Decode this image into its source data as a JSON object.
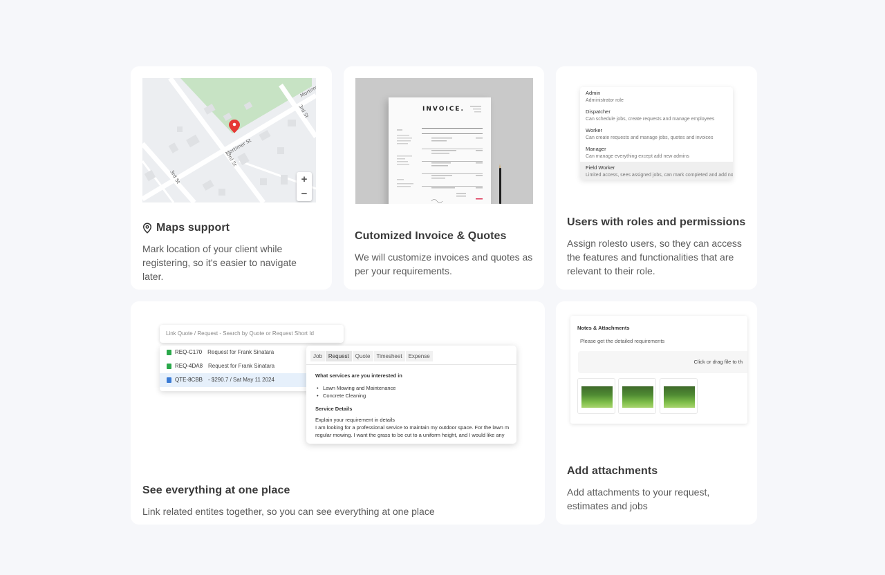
{
  "cards": {
    "maps": {
      "title": "Maps support",
      "description": "Mark location of your client while registering, so it's easier to navigate later.",
      "map": {
        "street_labels": [
          "Mortimer St",
          "Mortimer St",
          "3rd St",
          "3rd St",
          "3rd St"
        ],
        "zoom_in": "+",
        "zoom_out": "−"
      }
    },
    "invoice": {
      "title": "Cutomized Invoice & Quotes",
      "description": "We will customize invoices and quotes as per your requirements.",
      "invoice_heading": "INVOICE."
    },
    "roles": {
      "title": "Users with roles and permissions",
      "description": "Assign rolesto users, so they can access the features and functionalities that are relevant to their role.",
      "roles": [
        {
          "name": "Admin",
          "desc": "Administrator role"
        },
        {
          "name": "Dispatcher",
          "desc": "Can schedule jobs, create requests and manage employees"
        },
        {
          "name": "Worker",
          "desc": "Can create requests and manage jobs, quotes and invoices"
        },
        {
          "name": "Manager",
          "desc": "Can manage everything except add new admins"
        },
        {
          "name": "Field Worker",
          "desc": "Limited access, sees assigned jobs, can mark completed and add notes"
        }
      ]
    },
    "link": {
      "title": "See everything at one place",
      "description": "Link related entites together, so you can see everything at one place",
      "search_placeholder": "Link Quote / Request - Search by Quote or Request Short Id",
      "results": [
        {
          "id": "REQ-C170",
          "text": "Request for Frank Sinatara",
          "color": "#2aa84a"
        },
        {
          "id": "REQ-4DA8",
          "text": "Request for Frank Sinatara",
          "color": "#2aa84a"
        },
        {
          "id": "QTE-8CBB",
          "text": "- $290.7  / Sat May 11 2024",
          "color": "#3a7bd5"
        }
      ],
      "tabs": [
        "Job",
        "Request",
        "Quote",
        "Timesheet",
        "Expense"
      ],
      "detail": {
        "question": "What services are you interested in",
        "services": [
          "Lawn Mowing and Maintenance",
          "Concrete Cleaning"
        ],
        "section": "Service Details",
        "prompt": "Explain your requirement in details",
        "line1": "I am looking for a professional service to maintain my outdoor space. For the lawn m",
        "line2": "regular mowing. I want the grass to be cut to a uniform height, and I would like any"
      }
    },
    "attach": {
      "title": "Add attachments",
      "description": "Add attachments to your request, estimates and jobs",
      "panel_title": "Notes & Attachments",
      "panel_sub": "Please get the detailed requirements",
      "drop_text": "Click or drag file to th"
    }
  },
  "colors": {
    "background": "#f6f7fa",
    "card": "#ffffff",
    "park": "#c7e3c4",
    "pin": "#e53935"
  }
}
